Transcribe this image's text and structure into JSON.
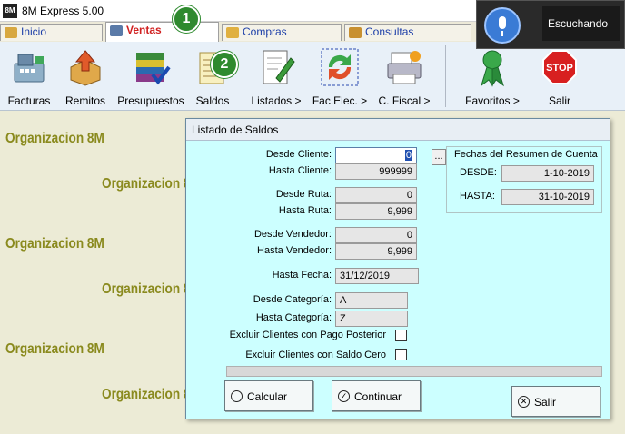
{
  "window": {
    "title": "8M Express 5.00",
    "app_icon_text": "8M"
  },
  "tabs": [
    {
      "label": "Inicio",
      "active": false
    },
    {
      "label": "Ventas",
      "active": true
    },
    {
      "label": "Compras",
      "active": false
    },
    {
      "label": "Consultas",
      "active": false
    }
  ],
  "badges": {
    "one": "1",
    "two": "2"
  },
  "toolbar": {
    "items": [
      {
        "label": "Facturas",
        "icon": "cash-register-icon"
      },
      {
        "label": "Remitos",
        "icon": "box-upload-icon"
      },
      {
        "label": "Presupuestos",
        "icon": "books-check-icon"
      },
      {
        "label": "Saldos",
        "icon": "notepad-icon"
      },
      {
        "label": "Listados >",
        "icon": "document-pen-icon"
      },
      {
        "label": "Fac.Elec. >",
        "icon": "refresh-arrows-icon"
      },
      {
        "label": "C. Fiscal  >",
        "icon": "fiscal-printer-icon"
      },
      {
        "label": "Favoritos  >",
        "icon": "ribbon-icon"
      },
      {
        "label": "Salir",
        "icon": "stop-sign-icon"
      }
    ],
    "stop_text": "STOP"
  },
  "voice": {
    "status": "Escuchando"
  },
  "watermark": {
    "text": "Organizacion 8M"
  },
  "dialog": {
    "title": "Listado de Saldos",
    "desde_cliente": {
      "label": "Desde Cliente:",
      "value": "0"
    },
    "hasta_cliente": {
      "label": "Hasta Cliente:",
      "value": "999999"
    },
    "desde_ruta": {
      "label": "Desde Ruta:",
      "value": "0"
    },
    "hasta_ruta": {
      "label": "Hasta Ruta:",
      "value": "9,999"
    },
    "desde_vendedor": {
      "label": "Desde Vendedor:",
      "value": "0"
    },
    "hasta_vendedor": {
      "label": "Hasta Vendedor:",
      "value": "9,999"
    },
    "hasta_fecha": {
      "label": "Hasta Fecha:",
      "value": "31/12/2019"
    },
    "desde_categoria": {
      "label": "Desde Categoría:",
      "value": "A"
    },
    "hasta_categoria": {
      "label": "Hasta Categoría:",
      "value": "Z"
    },
    "excluir_pago": {
      "label": "Excluir Clientes con Pago Posterior",
      "checked": false
    },
    "excluir_cero": {
      "label": "Excluir Clientes con Saldo Cero",
      "checked": false
    },
    "ellipsis": "...",
    "resumen": {
      "title": "Fechas del Resumen de Cuenta",
      "desde_label": "DESDE:",
      "desde_value": "1-10-2019",
      "hasta_label": "HASTA:",
      "hasta_value": "31-10-2019"
    },
    "buttons": {
      "calcular": "Calcular",
      "continuar": "Continuar",
      "salir": "Salir"
    }
  }
}
